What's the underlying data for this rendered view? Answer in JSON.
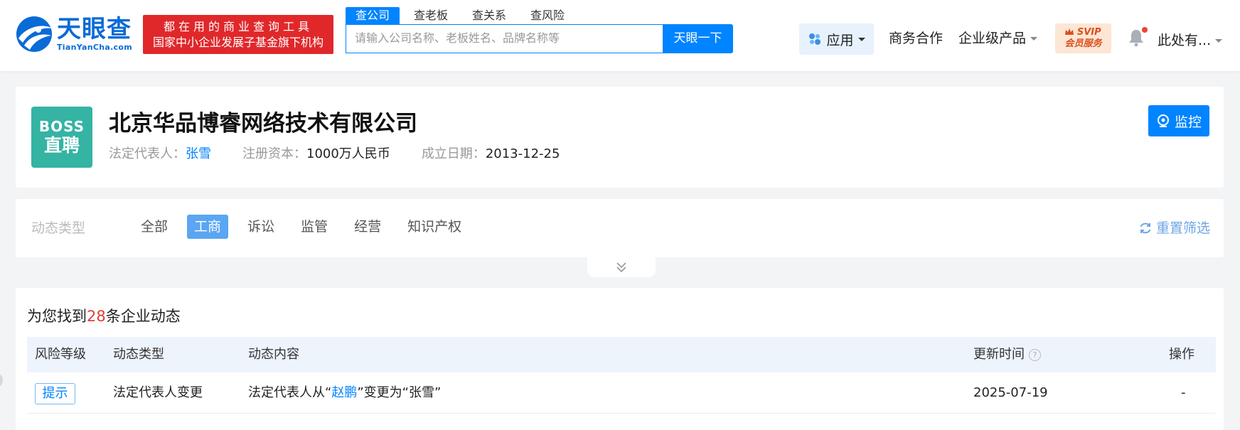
{
  "header": {
    "logo_cn": "天眼查",
    "logo_en": "TianYanCha.com",
    "slogan_line1": "都在用的商业查询工具",
    "slogan_line2": "国家中小企业发展子基金旗下机构",
    "search_tabs": [
      {
        "label": "查公司",
        "active": true
      },
      {
        "label": "查老板",
        "active": false
      },
      {
        "label": "查关系",
        "active": false
      },
      {
        "label": "查风险",
        "active": false
      }
    ],
    "search_placeholder": "请输入公司名称、老板姓名、品牌名称等",
    "search_button": "天眼一下",
    "nav": {
      "app": "应用",
      "business": "商务合作",
      "enterprise": "企业级产品",
      "svip_top": "SVIP",
      "svip_bottom": "会员服务",
      "user": "此处有..."
    },
    "icons": [
      "app-grid-icon",
      "bell-icon",
      "crown-icon"
    ]
  },
  "company": {
    "logo_line1": "BOSS",
    "logo_line2": "直聘",
    "logo_color": "#35b3a3",
    "name": "北京华品博睿网络技术有限公司",
    "legal_rep_label": "法定代表人：",
    "legal_rep_value": "张雪",
    "capital_label": "注册资本：",
    "capital_value": "1000万人民币",
    "founded_label": "成立日期：",
    "founded_value": "2013-12-25",
    "monitor_button": "监控"
  },
  "filter": {
    "label": "动态类型",
    "options": [
      {
        "label": "全部",
        "active": false
      },
      {
        "label": "工商",
        "active": true
      },
      {
        "label": "诉讼",
        "active": false
      },
      {
        "label": "监管",
        "active": false
      },
      {
        "label": "经营",
        "active": false
      },
      {
        "label": "知识产权",
        "active": false
      }
    ],
    "reset": "重置筛选"
  },
  "results": {
    "prefix": "为您找到",
    "count": "28",
    "suffix": "条企业动态",
    "columns": {
      "risk": "风险等级",
      "type": "动态类型",
      "content": "动态内容",
      "time": "更新时间",
      "action": "操作"
    },
    "rows": [
      {
        "risk": "提示",
        "type": "法定代表人变更",
        "content_pre": "法定代表人从“",
        "content_link": "赵鹏",
        "content_post": "”变更为“张雪”",
        "time": "2025-07-19",
        "action": "-"
      }
    ]
  },
  "colors": {
    "primary": "#0084ff",
    "slogan_bg": "#e0282b",
    "count_red": "#e23c3c",
    "svip_text": "#d9501e"
  }
}
